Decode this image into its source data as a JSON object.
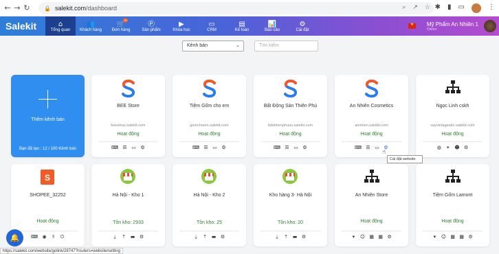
{
  "browser": {
    "url_host": "salekit.com",
    "url_path": "/dashboard",
    "nav": {
      "back": "←",
      "forward": "→",
      "reload": "↻"
    }
  },
  "header": {
    "logo": "Salekit",
    "menu": [
      {
        "label": "Tổng quan",
        "icon": "⌂",
        "icon_name": "home-icon",
        "active": true
      },
      {
        "label": "Khách hàng",
        "icon": "👥",
        "icon_name": "users-icon"
      },
      {
        "label": "Đơn hàng",
        "icon": "🛒",
        "icon_name": "cart-icon",
        "badge": "25"
      },
      {
        "label": "Sản phẩm",
        "icon": "Ⓟ",
        "icon_name": "product-icon"
      },
      {
        "label": "Khóa học",
        "icon": "▶",
        "icon_name": "course-icon"
      },
      {
        "label": "CRM",
        "icon": "▭",
        "icon_name": "crm-icon"
      },
      {
        "label": "Kế toán",
        "icon": "▤",
        "icon_name": "accounting-icon"
      },
      {
        "label": "Báo cáo",
        "icon": "📊",
        "icon_name": "report-icon"
      },
      {
        "label": "Cài đặt",
        "icon": "⚙",
        "icon_name": "settings-icon"
      }
    ],
    "user_name": "Mỹ Phẩm An Nhiên 1",
    "user_role": "Owner"
  },
  "filters": {
    "channel_select": "Kênh bán",
    "search_placeholder": "Tìm kiếm"
  },
  "add_card": {
    "label": "Thêm kênh bán",
    "count": "Bạn đã tạo : 12 / 100 Kênh bán"
  },
  "row1": [
    {
      "name": "BEE Store",
      "domain": "beeshop.salekit.com",
      "status": "Hoạt động"
    },
    {
      "name": "Tiệm Gốm cho em",
      "domain": "gomchoem.salekit.com",
      "status": "Hoạt động"
    },
    {
      "name": "Bất Động Sản Thiên Phú",
      "domain": "bdsthienphuuu.salekit.com",
      "status": "Hoạt động"
    },
    {
      "name": "An Nhiên Cosmetics",
      "domain": "annhien.salekit.com",
      "status": "Hoạt động"
    },
    {
      "name": "Ngọc Linh cskh",
      "domain": "vayvintageabc.salekit.com",
      "status": "Hoạt động"
    }
  ],
  "row2": [
    {
      "name": "SHOPEE_32252",
      "status": "Hoạt động"
    },
    {
      "name": "Hà Nội - Kho 1",
      "stock": "Tồn kho: 2933"
    },
    {
      "name": "Hà Nội - Kho 2",
      "stock": "Tồn kho: 25"
    },
    {
      "name": "Kho hàng 3- Hà Nội",
      "stock": "Tồn kho: 20"
    },
    {
      "name": "An Nhiên Store",
      "status": "Hoạt động"
    },
    {
      "name": "Tiệm Gốm Lamont",
      "status": "Hoạt động"
    }
  ],
  "tooltip": "Cài đặt website",
  "statusbar_url": "https://salekit.com/website/golink/28747?routers=website/setting"
}
